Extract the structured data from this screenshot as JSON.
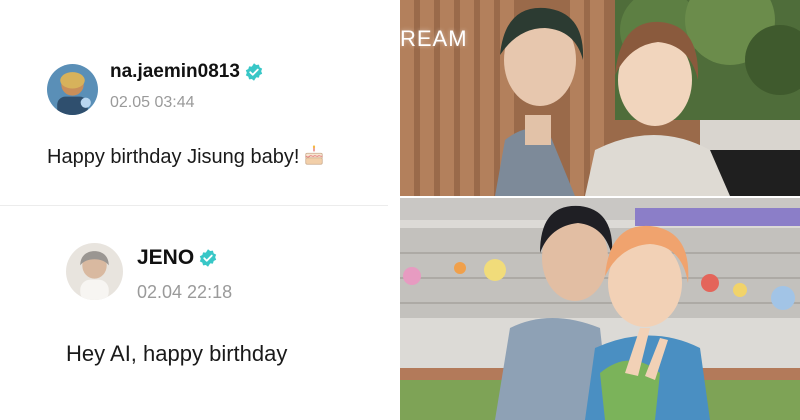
{
  "posts": [
    {
      "username": "na.jaemin0813",
      "timestamp": "02.05 03:44",
      "message": "Happy birthday Jisung baby!",
      "message_emoji": "birthday-cake"
    },
    {
      "username": "JENO",
      "timestamp": "02.04 22:18",
      "message": "Hey AI, happy birthday"
    }
  ],
  "photos": {
    "top_sign": "REAM"
  },
  "colors": {
    "verified": "#38c7c7",
    "timestamp": "#9a9a9a"
  }
}
